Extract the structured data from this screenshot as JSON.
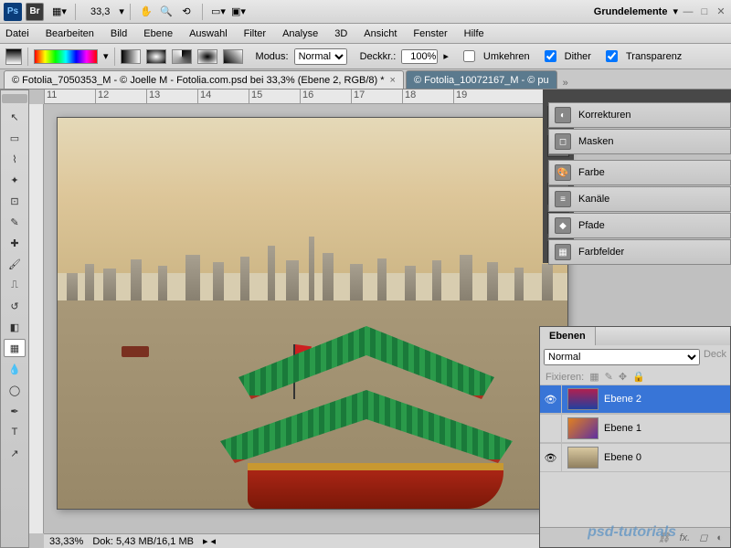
{
  "topbar": {
    "zoom": "33,3",
    "workspace": "Grundelemente"
  },
  "menu": {
    "datei": "Datei",
    "bearbeiten": "Bearbeiten",
    "bild": "Bild",
    "ebene": "Ebene",
    "auswahl": "Auswahl",
    "filter": "Filter",
    "analyse": "Analyse",
    "dd": "3D",
    "ansicht": "Ansicht",
    "fenster": "Fenster",
    "hilfe": "Hilfe"
  },
  "optbar": {
    "modus": "Modus:",
    "modus_val": "Normal",
    "deck": "Deckkr.:",
    "deck_val": "100%",
    "umkehren": "Umkehren",
    "dither": "Dither",
    "transparenz": "Transparenz"
  },
  "tabs": {
    "t1": "© Fotolia_7050353_M - © Joelle M - Fotolia.com.psd bei 33,3% (Ebene 2, RGB/8) *",
    "t2": "© Fotolia_10072167_M - © pu"
  },
  "ruler": {
    "n1": "11",
    "n2": "12",
    "n3": "13",
    "n4": "14",
    "n5": "15",
    "n6": "16",
    "n7": "17",
    "n8": "18",
    "n9": "19"
  },
  "status": {
    "zoom": "33,33%",
    "doc": "Dok: 5,43 MB/16,1 MB"
  },
  "side": {
    "korrekturen": "Korrekturen",
    "masken": "Masken",
    "farbe": "Farbe",
    "kanale": "Kanäle",
    "pfade": "Pfade",
    "farbfelder": "Farbfelder"
  },
  "layers": {
    "title": "Ebenen",
    "mode": "Normal",
    "deck": "Deck",
    "fixieren": "Fixieren:",
    "l2": "Ebene 2",
    "l1": "Ebene 1",
    "l0": "Ebene 0",
    "fx": "fx."
  },
  "watermark": "psd-tutorials"
}
